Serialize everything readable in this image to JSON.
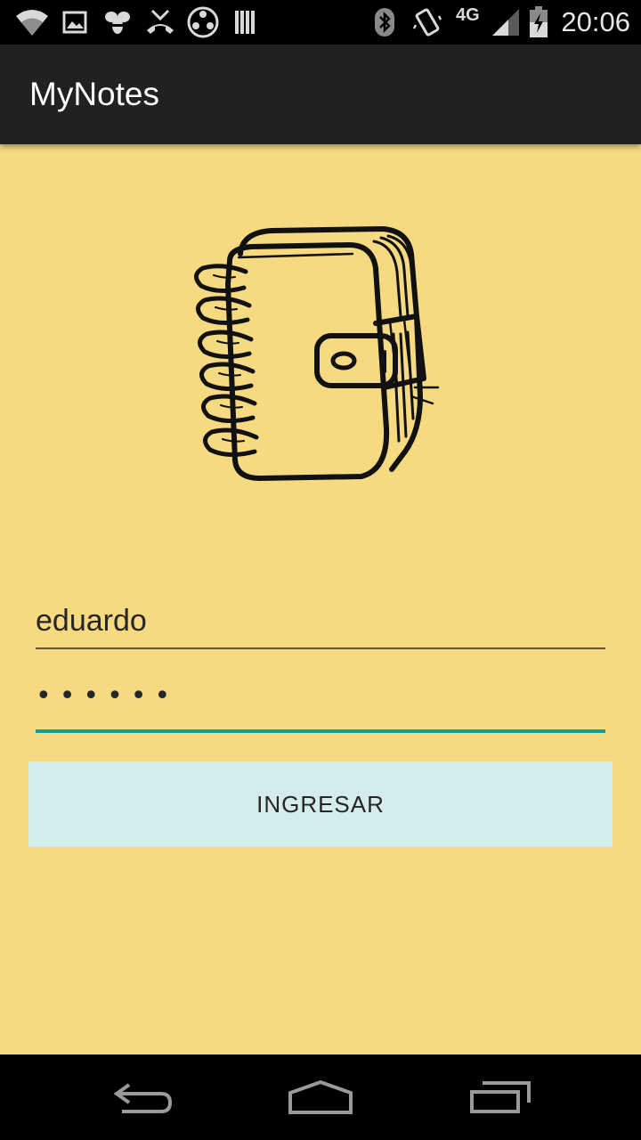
{
  "status_bar": {
    "time": "20:06",
    "network": "4G",
    "icons": [
      "wifi-icon",
      "image-icon",
      "bee-icon",
      "missed-call-icon",
      "media-icon",
      "storage-icon",
      "bluetooth-icon",
      "vibrate-icon",
      "signal-icon",
      "battery-icon"
    ]
  },
  "action_bar": {
    "title": "MyNotes"
  },
  "logo": {
    "icon": "notebook-icon"
  },
  "login_form": {
    "username_value": "eduardo",
    "password_mask": "••••••",
    "submit_label": "INGRESAR"
  },
  "nav_bar": {
    "buttons": [
      "back-icon",
      "home-icon",
      "recents-icon"
    ]
  },
  "colors": {
    "background": "#f5da82",
    "action_bar": "#212121",
    "accent": "#1a9c85",
    "button": "#d4ecec"
  }
}
